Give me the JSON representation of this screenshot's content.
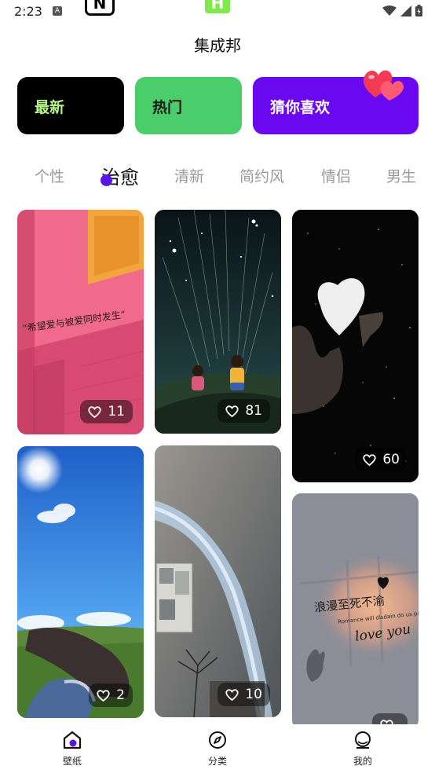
{
  "status_bar": {
    "time": "2:23",
    "notification_glyph": "A"
  },
  "app": {
    "title": "集成邦"
  },
  "categories": [
    {
      "label": "最新",
      "badge": "N",
      "color": "#000000"
    },
    {
      "label": "热门",
      "badge": "H",
      "color": "#4ccd6b"
    },
    {
      "label": "猜你喜欢",
      "badge_icon": "hearts-icon",
      "color": "#6a08f0"
    }
  ],
  "tabs": [
    {
      "label": "个性",
      "active": false
    },
    {
      "label": "治愈",
      "active": true
    },
    {
      "label": "清新",
      "active": false
    },
    {
      "label": "简约风",
      "active": false
    },
    {
      "label": "情侣",
      "active": false
    },
    {
      "label": "男生",
      "active": false
    }
  ],
  "wallpapers": [
    {
      "likes": "11",
      "text": "“希望爱与被爱同时发生”"
    },
    {
      "likes": "81"
    },
    {
      "likes": "60"
    },
    {
      "likes": "2"
    },
    {
      "likes": "10"
    },
    {
      "likes": "",
      "text_line1": "浪漫至死不渝",
      "text_line2": "Romance will disdain do us part",
      "text_line3": "love you"
    }
  ],
  "bottom_nav": [
    {
      "label": "壁纸",
      "icon": "home-wallpaper-icon",
      "active": true
    },
    {
      "label": "分类",
      "icon": "compass-icon",
      "active": false
    },
    {
      "label": "我的",
      "icon": "profile-icon",
      "active": false
    }
  ]
}
